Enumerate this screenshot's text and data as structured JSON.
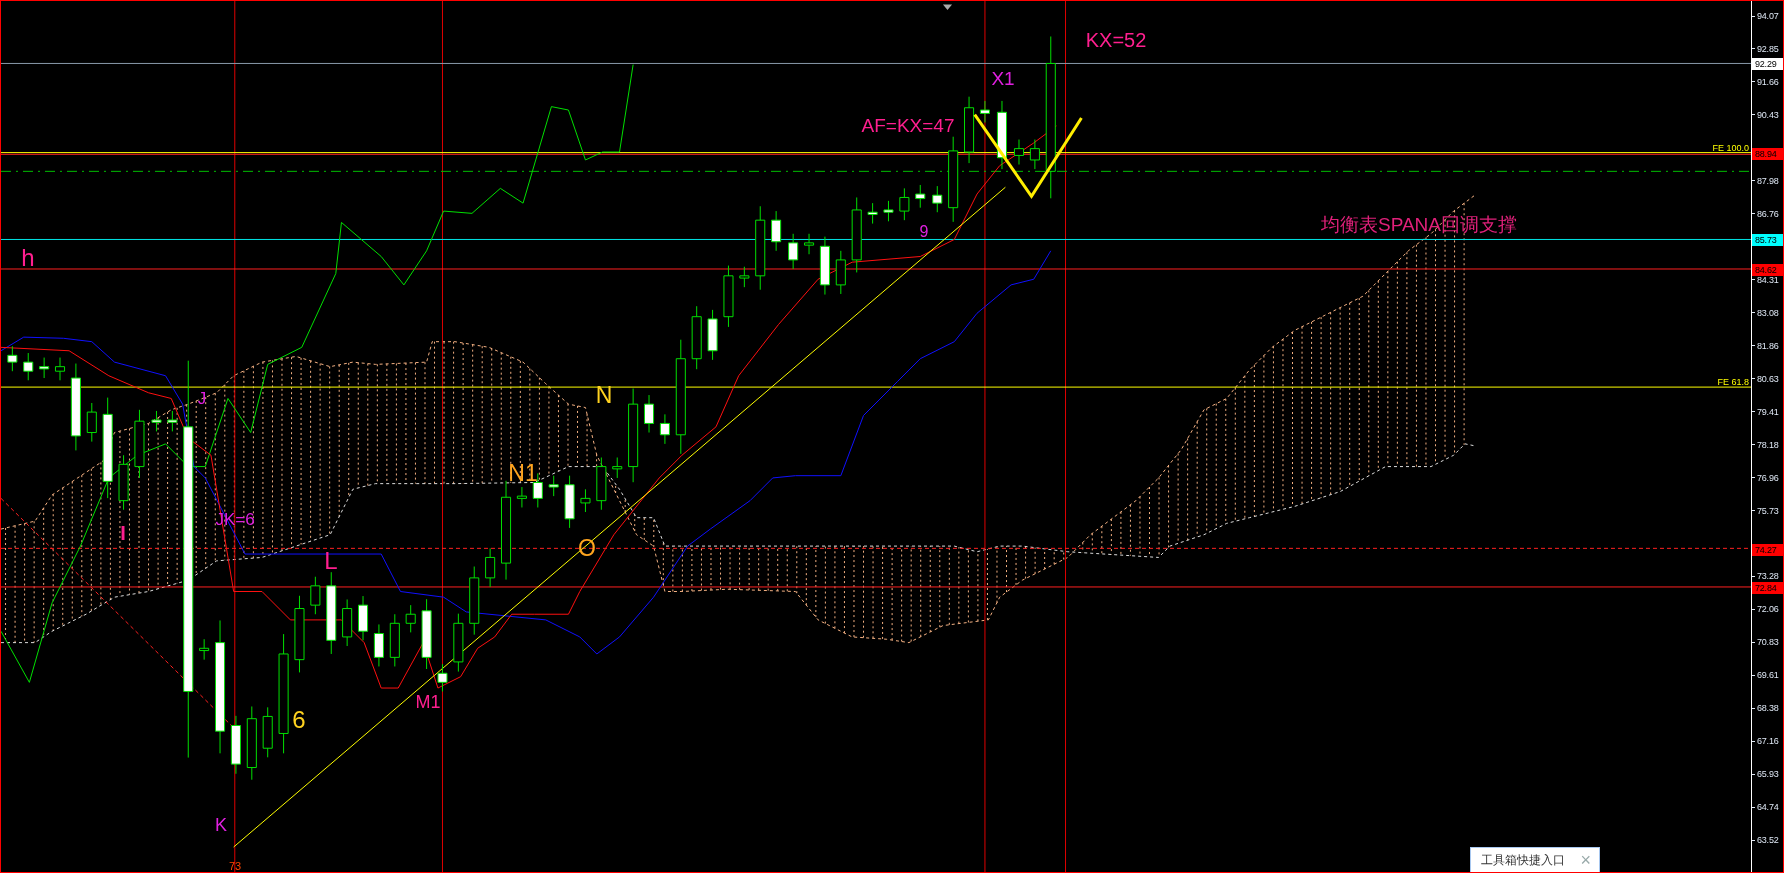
{
  "chart": {
    "annotations": [
      {
        "text": "KX=52",
        "color": "#ff1f8f"
      },
      {
        "text": "X1",
        "color": "#e020e0"
      },
      {
        "text": "AF=KX=47",
        "color": "#ff1f8f"
      },
      {
        "text": "9",
        "color": "#e020e0"
      },
      {
        "text": "均衡表SPANA回调支撑",
        "color": "#e0207a"
      },
      {
        "text": "h",
        "color": "#ff1f8f"
      },
      {
        "text": "J",
        "color": "#e020e0"
      },
      {
        "text": "N",
        "color": "#ffd21f"
      },
      {
        "text": "N1",
        "color": "#ffa51f"
      },
      {
        "text": "I",
        "color": "#ff1f8f"
      },
      {
        "text": "JK=6",
        "color": "#e020e0"
      },
      {
        "text": "O",
        "color": "#ffa51f"
      },
      {
        "text": "L",
        "color": "#ff1f8f"
      },
      {
        "text": "6",
        "color": "#ffd21f"
      },
      {
        "text": "M1",
        "color": "#ff1f8f"
      },
      {
        "text": "K",
        "color": "#e020e0"
      }
    ],
    "levels": [
      {
        "text": "FE 100.0"
      },
      {
        "text": "FE 61.8"
      }
    ],
    "time_label": "73"
  },
  "price_axis": {
    "ticks": [
      "94.07",
      "92.85",
      "91.66",
      "90.43",
      "87.98",
      "86.76",
      "84.31",
      "83.08",
      "81.86",
      "80.63",
      "79.41",
      "78.18",
      "76.96",
      "75.73",
      "73.28",
      "72.06",
      "70.83",
      "69.61",
      "68.38",
      "67.16",
      "65.93",
      "64.74",
      "63.52"
    ],
    "tags": [
      {
        "text": "92.29",
        "color": "#ffffff"
      },
      {
        "text": "88.94",
        "color": "#ff0000"
      },
      {
        "text": "85.73",
        "color": "#00ffff"
      },
      {
        "text": "84.62",
        "color": "#ff0000"
      },
      {
        "text": "74.27",
        "color": "#ff0000"
      },
      {
        "text": "72.84",
        "color": "#ff0000"
      }
    ]
  },
  "toolbox_popup": {
    "label": "工具箱快捷入口",
    "close": "×"
  }
}
